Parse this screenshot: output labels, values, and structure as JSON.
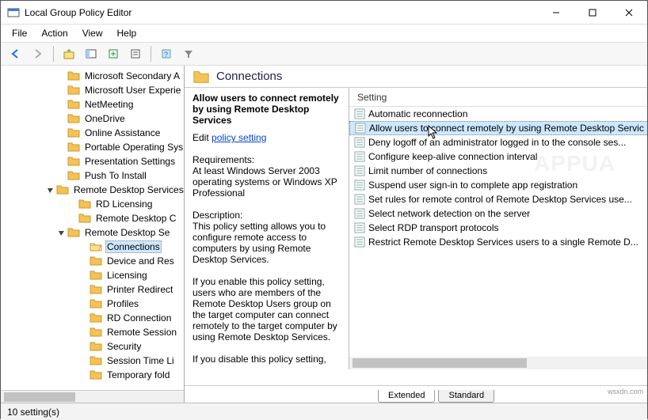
{
  "window": {
    "title": "Local Group Policy Editor"
  },
  "menu": {
    "file": "File",
    "action": "Action",
    "view": "View",
    "help": "Help"
  },
  "tree": {
    "items": [
      {
        "indent": 5,
        "expander": "",
        "label": "Microsoft Secondary A"
      },
      {
        "indent": 5,
        "expander": "",
        "label": "Microsoft User Experie"
      },
      {
        "indent": 5,
        "expander": "",
        "label": "NetMeeting"
      },
      {
        "indent": 5,
        "expander": "",
        "label": "OneDrive"
      },
      {
        "indent": 5,
        "expander": "",
        "label": "Online Assistance"
      },
      {
        "indent": 5,
        "expander": "",
        "label": "Portable Operating Sys"
      },
      {
        "indent": 5,
        "expander": "",
        "label": "Presentation Settings"
      },
      {
        "indent": 5,
        "expander": "",
        "label": "Push To Install"
      },
      {
        "indent": 4,
        "expander": "▾",
        "label": "Remote Desktop Services"
      },
      {
        "indent": 6,
        "expander": "",
        "label": "RD Licensing"
      },
      {
        "indent": 6,
        "expander": "",
        "label": "Remote Desktop C"
      },
      {
        "indent": 5,
        "expander": "▾",
        "label": "Remote Desktop Se"
      },
      {
        "indent": 7,
        "expander": "",
        "label": "Connections",
        "selected": true,
        "open": true
      },
      {
        "indent": 7,
        "expander": "",
        "label": "Device and Res"
      },
      {
        "indent": 7,
        "expander": "",
        "label": "Licensing"
      },
      {
        "indent": 7,
        "expander": "",
        "label": "Printer Redirect"
      },
      {
        "indent": 7,
        "expander": "",
        "label": "Profiles"
      },
      {
        "indent": 7,
        "expander": "",
        "label": "RD Connection"
      },
      {
        "indent": 7,
        "expander": "",
        "label": "Remote Session"
      },
      {
        "indent": 7,
        "expander": "",
        "label": "Security"
      },
      {
        "indent": 7,
        "expander": "",
        "label": "Session Time Li"
      },
      {
        "indent": 7,
        "expander": "",
        "label": "Temporary fold"
      }
    ]
  },
  "header": {
    "title": "Connections"
  },
  "description": {
    "heading": "Allow users to connect remotely by using Remote Desktop Services",
    "edit_prefix": "Edit ",
    "edit_link": "policy setting",
    "req_label": "Requirements:",
    "req_text": "At least Windows Server 2003 operating systems or Windows XP Professional",
    "desc_label": "Description:",
    "desc_text": "This policy setting allows you to configure remote access to computers by using Remote Desktop Services.",
    "enable_text": "If you enable this policy setting, users who are members of the Remote Desktop Users group on the target computer can connect remotely to the target computer by using Remote Desktop Services.",
    "disable_text": "If you disable this policy setting,"
  },
  "list": {
    "col_setting": "Setting",
    "items": [
      {
        "label": "Automatic reconnection"
      },
      {
        "label": "Allow users to connect remotely by using Remote Desktop Servic",
        "selected": true
      },
      {
        "label": "Deny logoff of an administrator logged in to the console ses..."
      },
      {
        "label": "Configure keep-alive connection interval"
      },
      {
        "label": "Limit number of connections"
      },
      {
        "label": "Suspend user sign-in to complete app registration"
      },
      {
        "label": "Set rules for remote control of Remote Desktop Services use..."
      },
      {
        "label": "Select network detection on the server"
      },
      {
        "label": "Select RDP transport protocols"
      },
      {
        "label": "Restrict Remote Desktop Services users to a single Remote D..."
      }
    ]
  },
  "tabs": {
    "extended": "Extended",
    "standard": "Standard"
  },
  "status": {
    "count": "10 setting(s)"
  },
  "attribution": "wsxdn.com"
}
